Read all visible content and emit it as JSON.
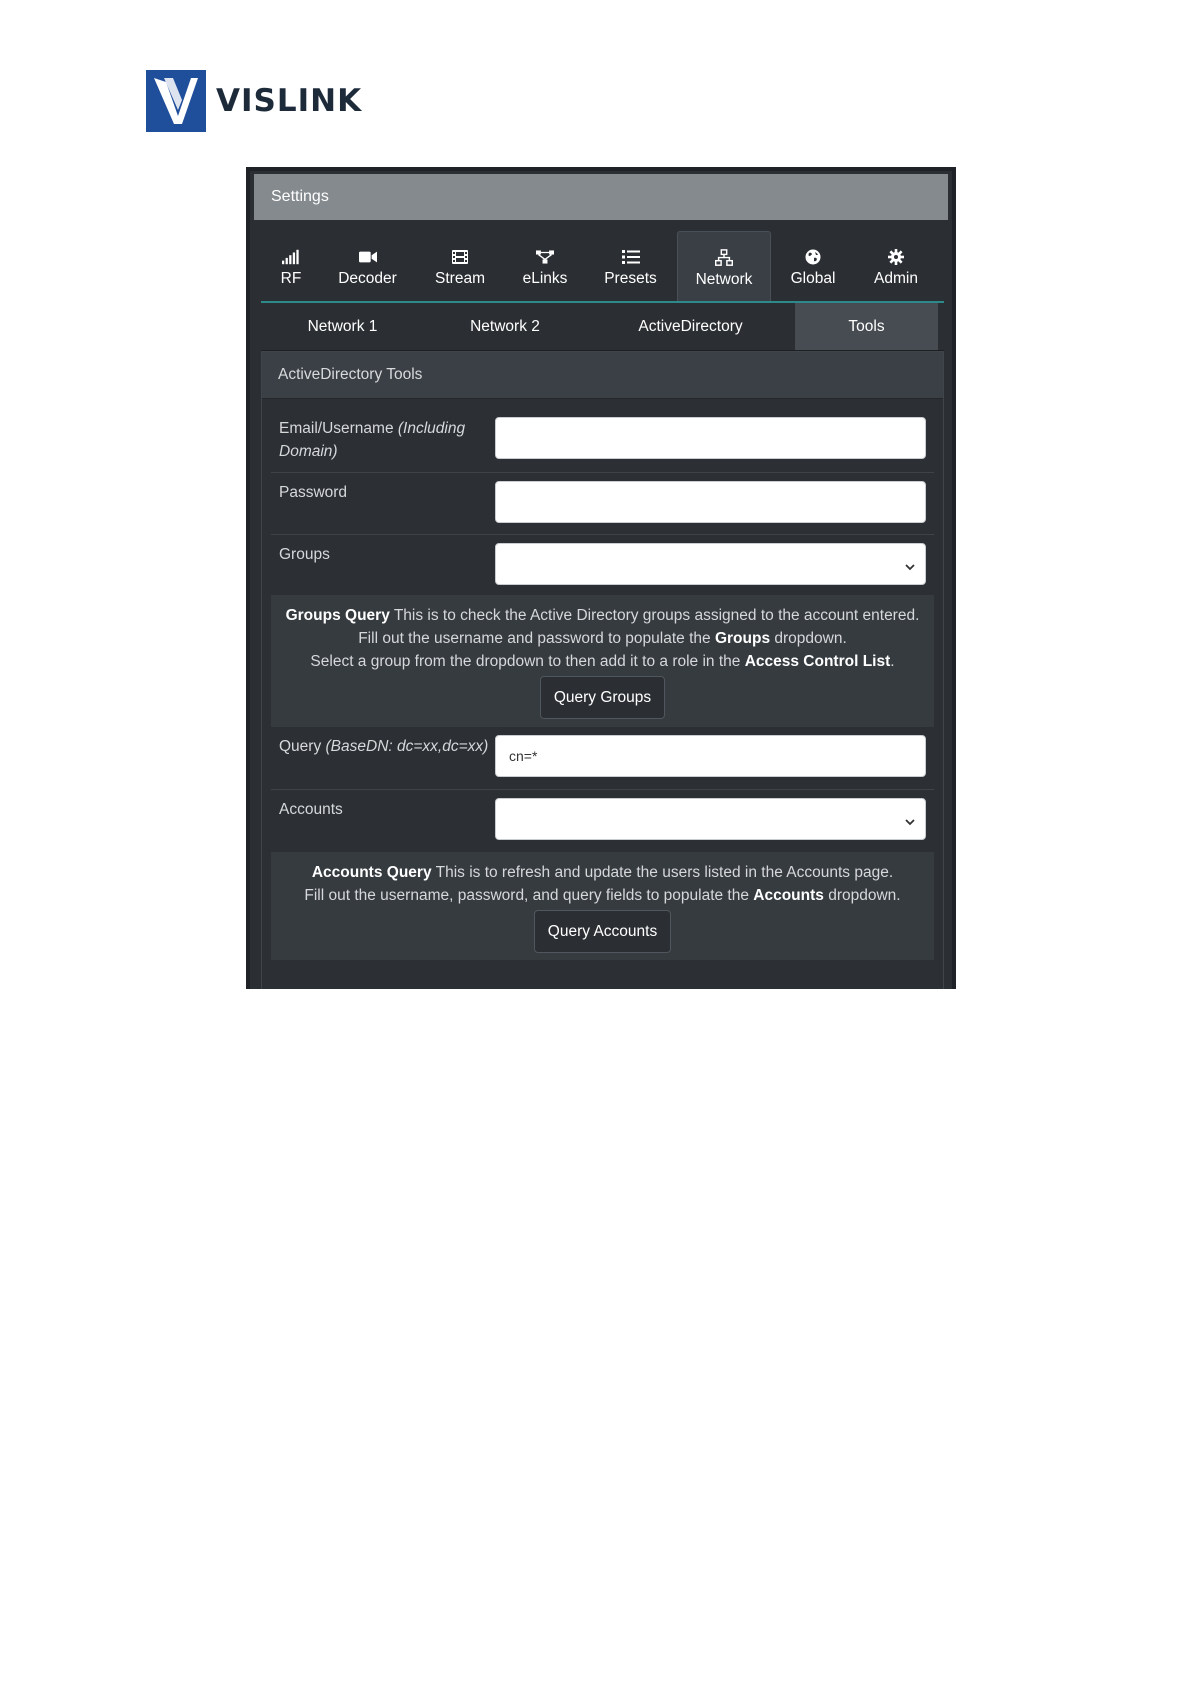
{
  "brand": {
    "name": "VISLINK",
    "logo_color": "#1f4e9b"
  },
  "settings": {
    "title": "Settings"
  },
  "main_tabs": [
    {
      "label": "RF",
      "icon": "signal-bars-icon"
    },
    {
      "label": "Decoder",
      "icon": "video-camera-icon"
    },
    {
      "label": "Stream",
      "icon": "film-icon"
    },
    {
      "label": "eLinks",
      "icon": "nodes-icon"
    },
    {
      "label": "Presets",
      "icon": "list-icon"
    },
    {
      "label": "Network",
      "icon": "network-icon",
      "active": true
    },
    {
      "label": "Global",
      "icon": "globe-icon"
    },
    {
      "label": "Admin",
      "icon": "gear-icon"
    }
  ],
  "sub_tabs": [
    {
      "label": "Network 1"
    },
    {
      "label": "Network 2"
    },
    {
      "label": "ActiveDirectory"
    },
    {
      "label": "Tools",
      "active": true
    }
  ],
  "tools": {
    "title": "ActiveDirectory Tools",
    "email_label": "Email/Username ",
    "email_label_em": "(Including Domain)",
    "email_value": "",
    "password_label": "Password",
    "password_value": "",
    "groups_label": "Groups",
    "groups_selected": "",
    "groups_info": {
      "title": "Groups Query",
      "line1": " This is to check the Active Directory groups assigned to the account entered.",
      "line2_a": "Fill out the username and password to populate the ",
      "line2_b": "Groups",
      "line2_c": " dropdown.",
      "line3_a": "Select a group from the dropdown to then add it to a role in the ",
      "line3_b": "Access Control List",
      "line3_c": "."
    },
    "query_groups_button": "Query Groups",
    "query_label": "Query ",
    "query_label_em": "(BaseDN: dc=xx,dc=xx)",
    "query_value": "cn=*",
    "accounts_label": "Accounts",
    "accounts_selected": "",
    "accounts_info": {
      "title": "Accounts Query",
      "line1": " This is to refresh and update the users listed in the Accounts page.",
      "line2_a": "Fill out the username, password, and query fields to populate the ",
      "line2_b": "Accounts",
      "line2_c": " dropdown."
    },
    "query_accounts_button": "Query Accounts"
  }
}
